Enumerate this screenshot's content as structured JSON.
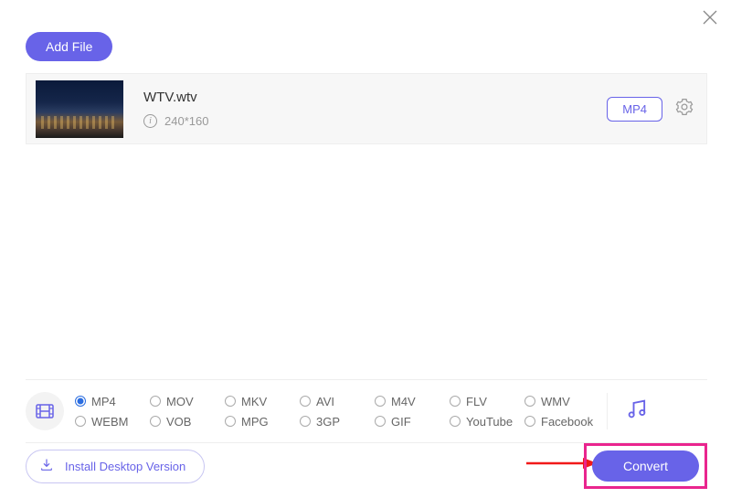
{
  "header": {
    "add_file_label": "Add File"
  },
  "file": {
    "name": "WTV.wtv",
    "resolution": "240*160",
    "target_format": "MP4"
  },
  "formats": {
    "options": [
      "MP4",
      "MOV",
      "MKV",
      "AVI",
      "M4V",
      "FLV",
      "WMV",
      "WEBM",
      "VOB",
      "MPG",
      "3GP",
      "GIF",
      "YouTube",
      "Facebook"
    ],
    "selected": "MP4"
  },
  "footer": {
    "install_label": "Install Desktop Version",
    "convert_label": "Convert"
  }
}
